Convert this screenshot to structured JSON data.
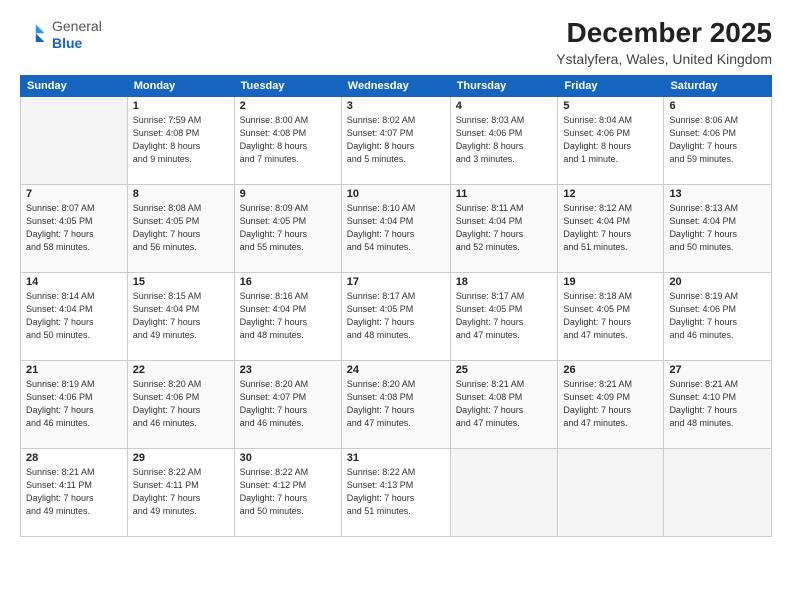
{
  "header": {
    "logo_line1": "General",
    "logo_line2": "Blue",
    "month_year": "December 2025",
    "location": "Ystalyfera, Wales, United Kingdom"
  },
  "days_of_week": [
    "Sunday",
    "Monday",
    "Tuesday",
    "Wednesday",
    "Thursday",
    "Friday",
    "Saturday"
  ],
  "weeks": [
    [
      {
        "day": "",
        "info": ""
      },
      {
        "day": "1",
        "info": "Sunrise: 7:59 AM\nSunset: 4:08 PM\nDaylight: 8 hours\nand 9 minutes."
      },
      {
        "day": "2",
        "info": "Sunrise: 8:00 AM\nSunset: 4:08 PM\nDaylight: 8 hours\nand 7 minutes."
      },
      {
        "day": "3",
        "info": "Sunrise: 8:02 AM\nSunset: 4:07 PM\nDaylight: 8 hours\nand 5 minutes."
      },
      {
        "day": "4",
        "info": "Sunrise: 8:03 AM\nSunset: 4:06 PM\nDaylight: 8 hours\nand 3 minutes."
      },
      {
        "day": "5",
        "info": "Sunrise: 8:04 AM\nSunset: 4:06 PM\nDaylight: 8 hours\nand 1 minute."
      },
      {
        "day": "6",
        "info": "Sunrise: 8:06 AM\nSunset: 4:06 PM\nDaylight: 7 hours\nand 59 minutes."
      }
    ],
    [
      {
        "day": "7",
        "info": "Sunrise: 8:07 AM\nSunset: 4:05 PM\nDaylight: 7 hours\nand 58 minutes."
      },
      {
        "day": "8",
        "info": "Sunrise: 8:08 AM\nSunset: 4:05 PM\nDaylight: 7 hours\nand 56 minutes."
      },
      {
        "day": "9",
        "info": "Sunrise: 8:09 AM\nSunset: 4:05 PM\nDaylight: 7 hours\nand 55 minutes."
      },
      {
        "day": "10",
        "info": "Sunrise: 8:10 AM\nSunset: 4:04 PM\nDaylight: 7 hours\nand 54 minutes."
      },
      {
        "day": "11",
        "info": "Sunrise: 8:11 AM\nSunset: 4:04 PM\nDaylight: 7 hours\nand 52 minutes."
      },
      {
        "day": "12",
        "info": "Sunrise: 8:12 AM\nSunset: 4:04 PM\nDaylight: 7 hours\nand 51 minutes."
      },
      {
        "day": "13",
        "info": "Sunrise: 8:13 AM\nSunset: 4:04 PM\nDaylight: 7 hours\nand 50 minutes."
      }
    ],
    [
      {
        "day": "14",
        "info": "Sunrise: 8:14 AM\nSunset: 4:04 PM\nDaylight: 7 hours\nand 50 minutes."
      },
      {
        "day": "15",
        "info": "Sunrise: 8:15 AM\nSunset: 4:04 PM\nDaylight: 7 hours\nand 49 minutes."
      },
      {
        "day": "16",
        "info": "Sunrise: 8:16 AM\nSunset: 4:04 PM\nDaylight: 7 hours\nand 48 minutes."
      },
      {
        "day": "17",
        "info": "Sunrise: 8:17 AM\nSunset: 4:05 PM\nDaylight: 7 hours\nand 48 minutes."
      },
      {
        "day": "18",
        "info": "Sunrise: 8:17 AM\nSunset: 4:05 PM\nDaylight: 7 hours\nand 47 minutes."
      },
      {
        "day": "19",
        "info": "Sunrise: 8:18 AM\nSunset: 4:05 PM\nDaylight: 7 hours\nand 47 minutes."
      },
      {
        "day": "20",
        "info": "Sunrise: 8:19 AM\nSunset: 4:06 PM\nDaylight: 7 hours\nand 46 minutes."
      }
    ],
    [
      {
        "day": "21",
        "info": "Sunrise: 8:19 AM\nSunset: 4:06 PM\nDaylight: 7 hours\nand 46 minutes."
      },
      {
        "day": "22",
        "info": "Sunrise: 8:20 AM\nSunset: 4:06 PM\nDaylight: 7 hours\nand 46 minutes."
      },
      {
        "day": "23",
        "info": "Sunrise: 8:20 AM\nSunset: 4:07 PM\nDaylight: 7 hours\nand 46 minutes."
      },
      {
        "day": "24",
        "info": "Sunrise: 8:20 AM\nSunset: 4:08 PM\nDaylight: 7 hours\nand 47 minutes."
      },
      {
        "day": "25",
        "info": "Sunrise: 8:21 AM\nSunset: 4:08 PM\nDaylight: 7 hours\nand 47 minutes."
      },
      {
        "day": "26",
        "info": "Sunrise: 8:21 AM\nSunset: 4:09 PM\nDaylight: 7 hours\nand 47 minutes."
      },
      {
        "day": "27",
        "info": "Sunrise: 8:21 AM\nSunset: 4:10 PM\nDaylight: 7 hours\nand 48 minutes."
      }
    ],
    [
      {
        "day": "28",
        "info": "Sunrise: 8:21 AM\nSunset: 4:11 PM\nDaylight: 7 hours\nand 49 minutes."
      },
      {
        "day": "29",
        "info": "Sunrise: 8:22 AM\nSunset: 4:11 PM\nDaylight: 7 hours\nand 49 minutes."
      },
      {
        "day": "30",
        "info": "Sunrise: 8:22 AM\nSunset: 4:12 PM\nDaylight: 7 hours\nand 50 minutes."
      },
      {
        "day": "31",
        "info": "Sunrise: 8:22 AM\nSunset: 4:13 PM\nDaylight: 7 hours\nand 51 minutes."
      },
      {
        "day": "",
        "info": ""
      },
      {
        "day": "",
        "info": ""
      },
      {
        "day": "",
        "info": ""
      }
    ]
  ]
}
